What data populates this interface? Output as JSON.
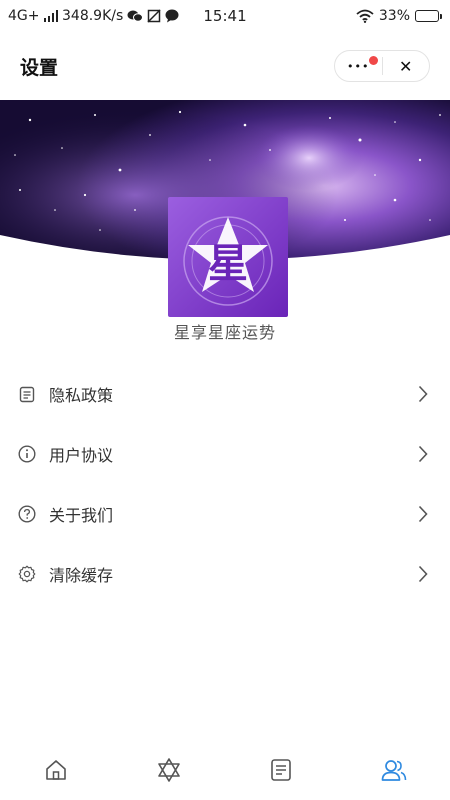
{
  "status_bar": {
    "network": "4G+",
    "speed": "348.9K/s",
    "time": "15:41",
    "battery_text": "33%",
    "battery_level": 0.33,
    "icons": [
      "signal-icon",
      "wechat-icon",
      "no-image-icon",
      "message-icon",
      "wifi-icon",
      "battery-icon"
    ]
  },
  "header": {
    "title": "设置",
    "more_label": "•••",
    "close_label": "✕"
  },
  "app": {
    "name": "星享星座运势",
    "logo_glyph": "星"
  },
  "menu": [
    {
      "label": "隐私政策",
      "icon": "document-icon"
    },
    {
      "label": "用户协议",
      "icon": "info-icon"
    },
    {
      "label": "关于我们",
      "icon": "question-icon"
    },
    {
      "label": "清除缓存",
      "icon": "gear-icon"
    }
  ],
  "tab_bar": {
    "tabs": [
      {
        "icon": "home-icon",
        "active": false
      },
      {
        "icon": "hexagram-icon",
        "active": false
      },
      {
        "icon": "article-icon",
        "active": false
      },
      {
        "icon": "users-icon",
        "active": true
      }
    ],
    "active_color": "#2f8ae0",
    "inactive_color": "#555555"
  },
  "colors": {
    "accent_red": "#f04848",
    "logo_purple": "#7b35c9",
    "banner_dark": "#1a0f3d"
  }
}
